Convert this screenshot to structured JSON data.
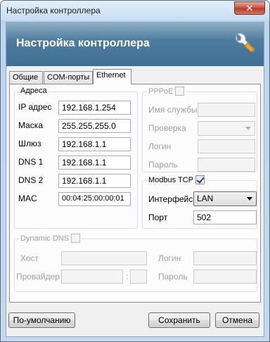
{
  "window": {
    "title": "Настройка контроллера",
    "close_label": "✕"
  },
  "banner": {
    "title": "Настройка контроллера"
  },
  "tabs": [
    "Общие",
    "COM-порты",
    "Ethernet"
  ],
  "address": {
    "legend": "Адреса",
    "ip_label": "IP адрес",
    "ip_value": "192.168.1.254",
    "mask_label": "Маска",
    "mask_value": "255.255.255.0",
    "gateway_label": "Шлюз",
    "gateway_value": "192.168.1.1",
    "dns1_label": "DNS 1",
    "dns1_value": "192.168.1.1",
    "dns2_label": "DNS 2",
    "dns2_value": "192.168.1.1",
    "mac_label": "MAC",
    "mac_value": "00:04:25:00:00:01"
  },
  "pppoe": {
    "legend": "PPPoE",
    "enabled": false,
    "service_label": "Имя службы",
    "check_label": "Проверка",
    "login_label": "Логин",
    "password_label": "Пароль"
  },
  "modbus": {
    "legend": "Modbus TCP",
    "enabled": true,
    "interface_label": "Интерфейс",
    "interface_value": "LAN",
    "port_label": "Порт",
    "port_value": "502"
  },
  "ddns": {
    "legend": "Dynamic DNS",
    "enabled": false,
    "host_label": "Хост",
    "login_label": "Логин",
    "provider_label": "Провайдер",
    "password_label": "Пароль",
    "provider_separator": ":"
  },
  "buttons": {
    "defaults": "По-умолчанию",
    "save": "Сохранить",
    "cancel": "Отмена"
  },
  "colors": {
    "banner": "#4e7d9e",
    "title_bg": "#c6ddf3",
    "close": "#c74f3c",
    "wrench": "#f5a623"
  }
}
